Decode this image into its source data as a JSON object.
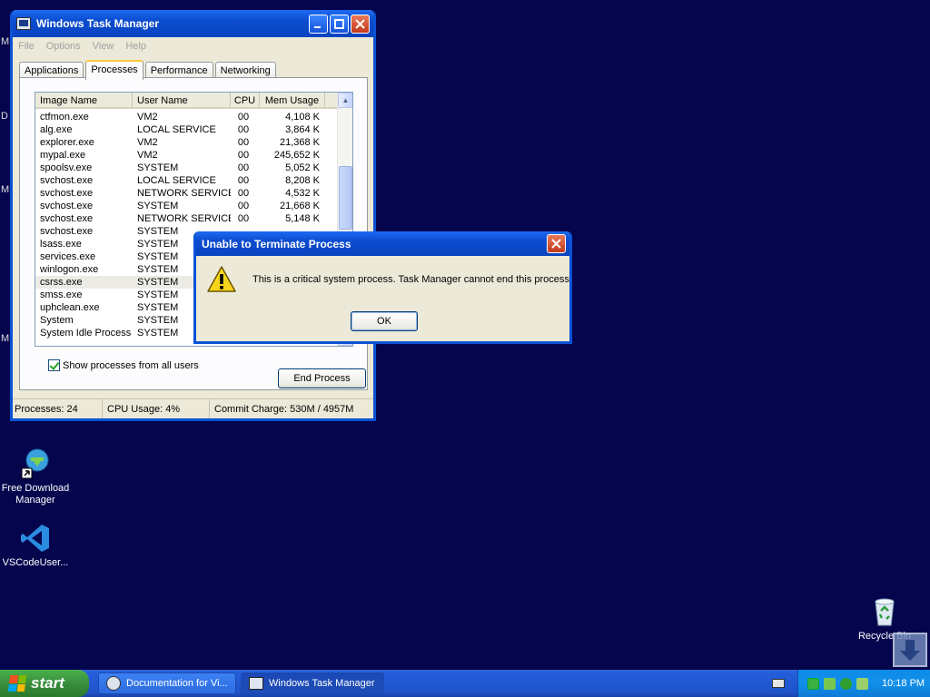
{
  "desktop": {
    "edge_letters": [
      "M",
      "D",
      "M",
      "M"
    ],
    "icons": [
      {
        "label_line1": "Free Download",
        "label_line2": "Manager"
      },
      {
        "label_line1": "VSCodeUser...",
        "label_line2": ""
      },
      {
        "label_line1": "Recycle Bin",
        "label_line2": ""
      }
    ]
  },
  "task_manager": {
    "title": "Windows Task Manager",
    "menu": [
      "File",
      "Options",
      "View",
      "Help"
    ],
    "tabs": [
      "Applications",
      "Processes",
      "Performance",
      "Networking"
    ],
    "active_tab": "Processes",
    "columns": [
      "Image Name",
      "User Name",
      "CPU",
      "Mem Usage"
    ],
    "processes": [
      {
        "name": "ctfmon.exe",
        "user": "VM2",
        "cpu": "00",
        "mem": "4,108 K"
      },
      {
        "name": "alg.exe",
        "user": "LOCAL SERVICE",
        "cpu": "00",
        "mem": "3,864 K"
      },
      {
        "name": "explorer.exe",
        "user": "VM2",
        "cpu": "00",
        "mem": "21,368 K"
      },
      {
        "name": "mypal.exe",
        "user": "VM2",
        "cpu": "00",
        "mem": "245,652 K"
      },
      {
        "name": "spoolsv.exe",
        "user": "SYSTEM",
        "cpu": "00",
        "mem": "5,052 K"
      },
      {
        "name": "svchost.exe",
        "user": "LOCAL SERVICE",
        "cpu": "00",
        "mem": "8,208 K"
      },
      {
        "name": "svchost.exe",
        "user": "NETWORK SERVICE",
        "cpu": "00",
        "mem": "4,532 K"
      },
      {
        "name": "svchost.exe",
        "user": "SYSTEM",
        "cpu": "00",
        "mem": "21,668 K"
      },
      {
        "name": "svchost.exe",
        "user": "NETWORK SERVICE",
        "cpu": "00",
        "mem": "5,148 K"
      },
      {
        "name": "svchost.exe",
        "user": "SYSTEM",
        "cpu": "",
        "mem": ""
      },
      {
        "name": "lsass.exe",
        "user": "SYSTEM",
        "cpu": "",
        "mem": ""
      },
      {
        "name": "services.exe",
        "user": "SYSTEM",
        "cpu": "",
        "mem": ""
      },
      {
        "name": "winlogon.exe",
        "user": "SYSTEM",
        "cpu": "",
        "mem": ""
      },
      {
        "name": "csrss.exe",
        "user": "SYSTEM",
        "cpu": "",
        "mem": "",
        "selected": true
      },
      {
        "name": "smss.exe",
        "user": "SYSTEM",
        "cpu": "",
        "mem": ""
      },
      {
        "name": "uphclean.exe",
        "user": "SYSTEM",
        "cpu": "",
        "mem": ""
      },
      {
        "name": "System",
        "user": "SYSTEM",
        "cpu": "",
        "mem": ""
      },
      {
        "name": "System Idle Process",
        "user": "SYSTEM",
        "cpu": "",
        "mem": ""
      }
    ],
    "show_all_label": "Show processes from all users",
    "show_all_checked": true,
    "end_process_label": "End Process",
    "status": {
      "processes": "Processes: 24",
      "cpu": "CPU Usage: 4%",
      "commit": "Commit Charge: 530M / 4957M"
    }
  },
  "dialog": {
    "title": "Unable to Terminate Process",
    "message": "This is a critical system process.  Task Manager cannot end this process.",
    "ok_label": "OK"
  },
  "taskbar": {
    "start_label": "start",
    "buttons": [
      {
        "label": "Documentation for Vi...",
        "active": false
      },
      {
        "label": "Windows Task Manager",
        "active": true
      }
    ],
    "clock": "10:18 PM"
  },
  "colors": {
    "desktop_bg": "#05054e",
    "title_blue": "#0b4ccf",
    "start_green": "#388e3c"
  }
}
